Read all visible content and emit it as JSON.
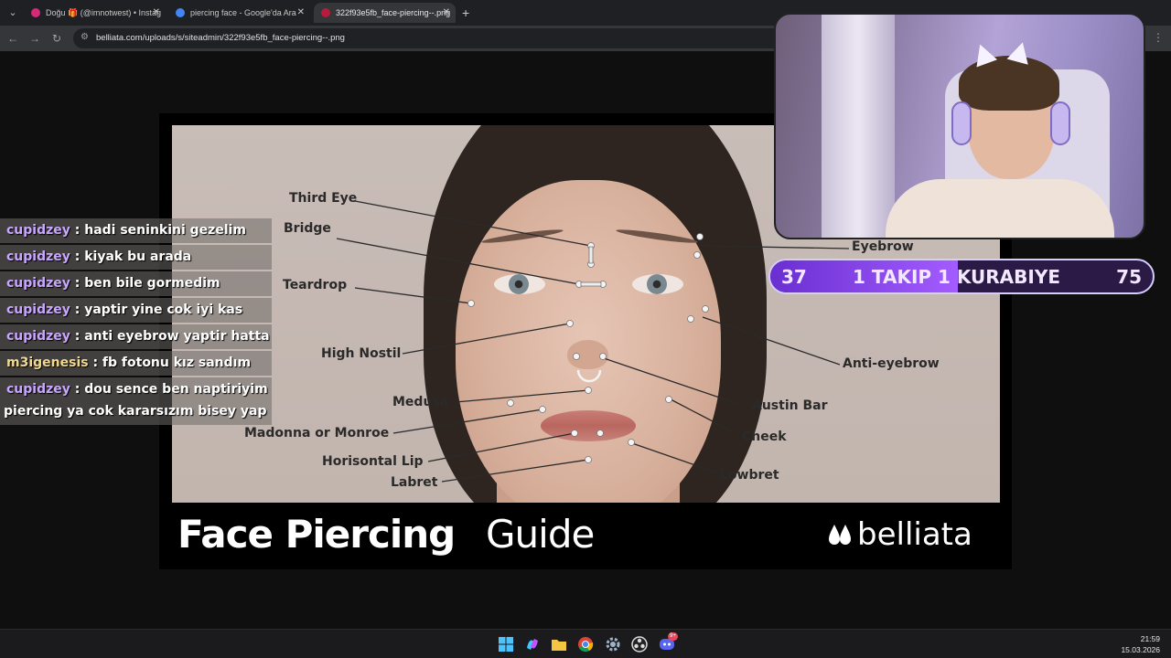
{
  "browser": {
    "tabs": [
      {
        "label": "Doğu 🎁 (@imnotwest) • Instag",
        "active": false,
        "favicon_color": "#d62976"
      },
      {
        "label": "piercing face - Google'da Ara",
        "active": false,
        "favicon_color": "#4285f4"
      },
      {
        "label": "322f93e5fb_face-piercing--.png",
        "active": true,
        "favicon_color": "#b71c3c"
      }
    ],
    "url": "belliata.com/uploads/s/siteadmin/322f93e5fb_face-piercing--.png"
  },
  "infographic": {
    "labels": {
      "third_eye": "Third Eye",
      "bridge": "Bridge",
      "teardrop": "Teardrop",
      "high_nostil": "High Nostil",
      "medusa": "Medusa",
      "madonna": "Madonna or Monroe",
      "horisontal_lip": "Horisontal Lip",
      "labret": "Labret",
      "eyebrow": "Eyebrow",
      "anti_eyebrow": "Anti-eyebrow",
      "austin_bar": "Austin Bar",
      "cheek": "Cheek",
      "lowbret": "Lowbret"
    },
    "title_bold": "Face Piercing",
    "title_light": "Guide",
    "brand": "belliata"
  },
  "chat": [
    {
      "user": "cupidzey",
      "text": " : hadi seninkini gezelim"
    },
    {
      "user": "cupidzey",
      "text": " : kiyak bu arada"
    },
    {
      "user": "cupidzey",
      "text": " : ben bile gormedim"
    },
    {
      "user": "cupidzey",
      "text": " : yaptir yine cok iyi kas"
    },
    {
      "user": "cupidzey",
      "text": " : anti eyebrow yaptir hatta"
    },
    {
      "user": "m3igenesis",
      "text": " : fb fotonu kız sandım"
    },
    {
      "user": "cupidzey",
      "text": " : dou sence ben naptiriyim",
      "continuation": "piercing ya cok kararsızım bisey yap"
    }
  ],
  "goal": {
    "current": "37",
    "title": "1 TAKIP 1 KURABIYE",
    "target": "75",
    "progress": 0.49
  },
  "taskbar": {
    "time": "21:59",
    "date": "15.03.2026",
    "discord_badge": "9+"
  }
}
